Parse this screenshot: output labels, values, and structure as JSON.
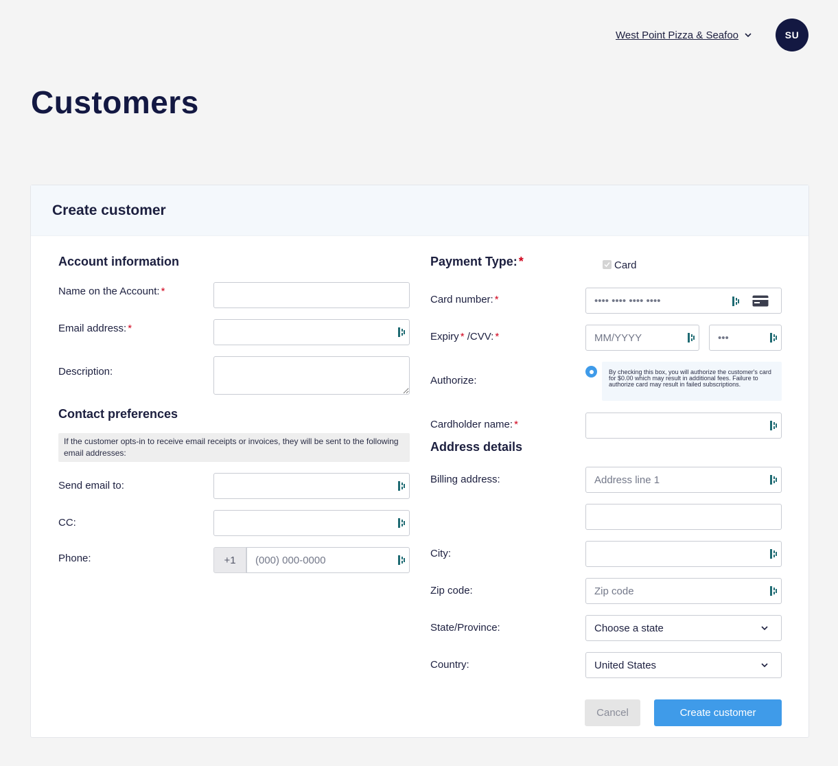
{
  "header": {
    "org_name": "West Point Pizza & Seafoo",
    "avatar_initials": "SU"
  },
  "page": {
    "title": "Customers"
  },
  "form": {
    "title": "Create customer",
    "account": {
      "section_title": "Account information",
      "name_label": "Name on the Account:",
      "email_label": "Email address:",
      "description_label": "Description:",
      "required_mark": "*"
    },
    "contact": {
      "section_title": "Contact preferences",
      "note": "If the customer opts-in to receive email receipts or invoices, they will be sent to the following email addresses:",
      "send_email_label": "Send email to:",
      "cc_label": "CC:",
      "phone_label": "Phone:",
      "phone_prefix": "+1",
      "phone_placeholder": "(000) 000-0000"
    },
    "payment": {
      "section_title": "Payment Type:",
      "card_option": "Card",
      "card_number_label": "Card number:",
      "card_number_placeholder": "•••• •••• •••• ••••",
      "expiry_label": "Expiry",
      "cvv_label": "/CVV:",
      "expiry_placeholder": "MM/YYYY",
      "cvv_placeholder": "•••",
      "authorize_label": "Authorize:",
      "authorize_text": "By checking this box, you will authorize the customer's card for $0.00 which may result in additional fees. Failure to authorize card may result in failed subscriptions.",
      "cardholder_label": "Cardholder name:"
    },
    "address": {
      "section_title": "Address details",
      "billing_label": "Billing address:",
      "line1_placeholder": "Address line 1",
      "city_label": "City:",
      "zip_label": "Zip code:",
      "zip_placeholder": "Zip code",
      "state_label": "State/Province:",
      "state_value": "Choose a state",
      "country_label": "Country:",
      "country_value": "United States"
    },
    "actions": {
      "cancel": "Cancel",
      "submit": "Create customer"
    }
  },
  "colors": {
    "navy": "#131842",
    "primary": "#3f9be9",
    "required": "#d0021b",
    "background": "#f4f4f4"
  }
}
